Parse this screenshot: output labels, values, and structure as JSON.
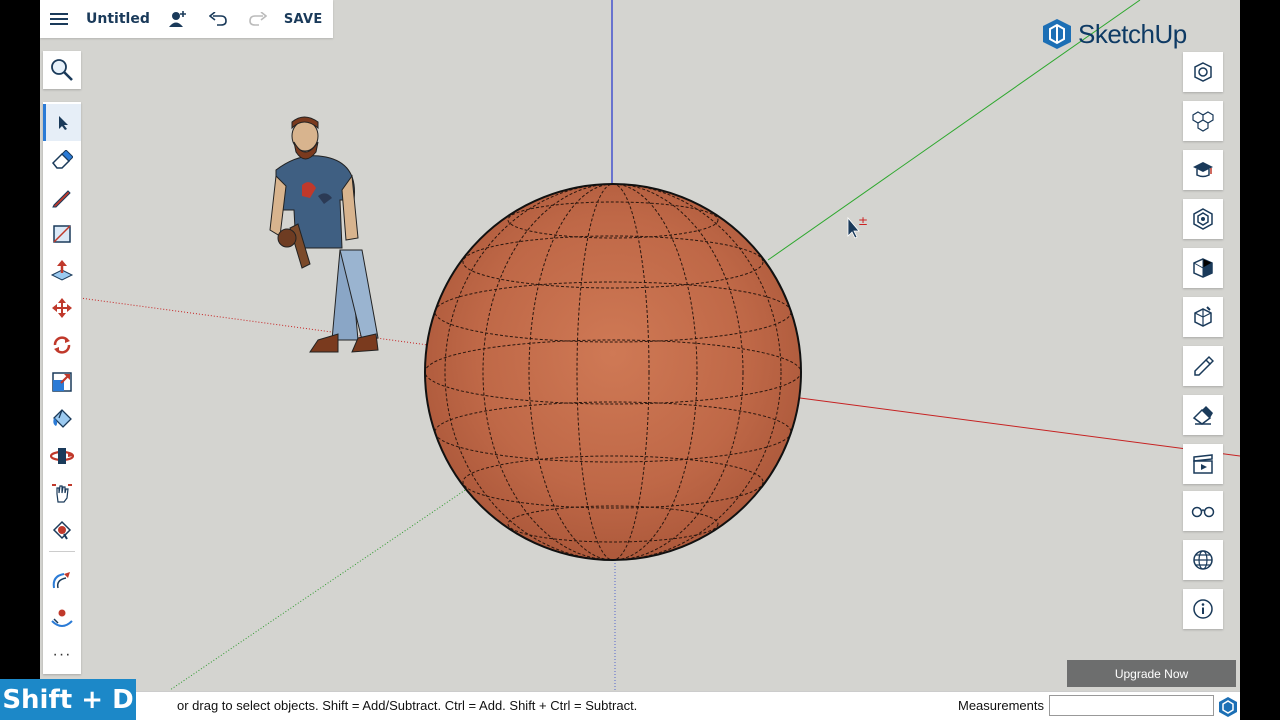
{
  "topbar": {
    "doc_title": "Untitled",
    "save_label": "SAVE"
  },
  "logo": {
    "text": "SketchUp"
  },
  "upgrade": {
    "label": "Upgrade Now"
  },
  "status": {
    "hint": "or drag to select objects. Shift = Add/Subtract. Ctrl = Add. Shift + Ctrl = Subtract.",
    "measurements_label": "Measurements",
    "measurements_value": ""
  },
  "shortcut_overlay": "Shift + D",
  "left_tools": [
    {
      "name": "select-tool",
      "icon": "arrow-cursor-icon",
      "active": true
    },
    {
      "name": "eraser-tool",
      "icon": "eraser-icon"
    },
    {
      "name": "line-tool",
      "icon": "pencil-icon"
    },
    {
      "name": "rectangle-tool",
      "icon": "rectangle-icon"
    },
    {
      "name": "push-pull-tool",
      "icon": "push-pull-icon"
    },
    {
      "name": "move-tool",
      "icon": "move-arrows-icon"
    },
    {
      "name": "rotate-tool",
      "icon": "rotate-icon"
    },
    {
      "name": "scale-tool",
      "icon": "scale-icon"
    },
    {
      "name": "paint-bucket-tool",
      "icon": "paint-bucket-icon"
    },
    {
      "name": "orbit-tool",
      "icon": "orbit-icon"
    },
    {
      "name": "pan-tool",
      "icon": "hand-icon"
    },
    {
      "name": "zoom-extents-tool",
      "icon": "zoom-window-icon"
    },
    {
      "name": "tape-measure-tool",
      "icon": "tape-measure-icon"
    },
    {
      "name": "follow-me-tool",
      "icon": "follow-me-icon"
    }
  ],
  "more_tools": "···",
  "right_panels": [
    "entity-info-icon",
    "components-icon",
    "instructor-icon",
    "outliner-icon",
    "views-icon",
    "styles-icon",
    "materials-icon",
    "tags-icon",
    "scenes-icon",
    "display-icon",
    "shadows-icon",
    "info-icon"
  ],
  "colors": {
    "accent": "#1c88c8",
    "brand_navy": "#0e3a64",
    "sphere": "#c0694a",
    "background": "#d4d4d0",
    "axis_red": "#cc2222",
    "axis_green": "#22aa22",
    "axis_blue": "#2222cc"
  }
}
